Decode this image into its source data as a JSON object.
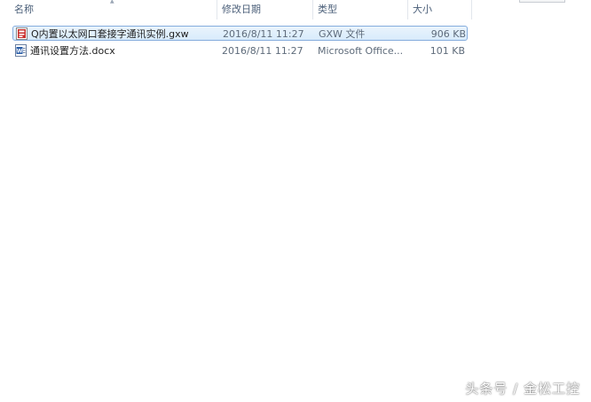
{
  "columns": {
    "name": "名称",
    "date_modified": "修改日期",
    "type": "类型",
    "size": "大小"
  },
  "files": [
    {
      "name": "Q内置以太网口套接字通讯实例.gxw",
      "date": "2016/8/11 11:27",
      "type": "GXW 文件",
      "size": "906 KB",
      "icon": "gxw-file-icon",
      "selected": true
    },
    {
      "name": "通讯设置方法.docx",
      "date": "2016/8/11 11:27",
      "type": "Microsoft Office...",
      "size": "101 KB",
      "icon": "word-document-icon",
      "selected": false
    }
  ],
  "watermark": "头条号 / 金松工控",
  "colors": {
    "selection_border": "#84acdd",
    "selection_fill": "#d8ebfb",
    "header_text": "#4c607a",
    "gxw_icon": "#c8302c",
    "word_icon": "#2b5ea8"
  }
}
